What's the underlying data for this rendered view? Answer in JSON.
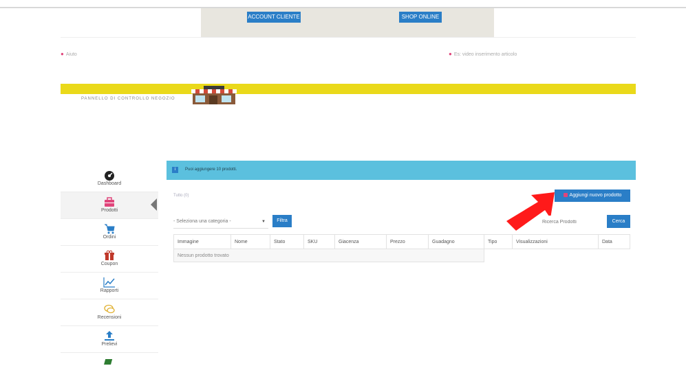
{
  "top_buttons": {
    "account": "ACCOUNT CLIENTE",
    "shop": "SHOP ONLINE"
  },
  "links": {
    "aiuto": "Aiuto",
    "video": "Es: video inserimento articolo"
  },
  "panel_label": "PANNELLO DI CONTROLLO NEGOZIO",
  "sidebar": {
    "items": [
      {
        "label": "Dashboard",
        "icon": "dashboard-icon",
        "color": "#222222"
      },
      {
        "label": "Prodotti",
        "icon": "briefcase-icon",
        "color": "#e0457b"
      },
      {
        "label": "Ordini",
        "icon": "cart-icon",
        "color": "#2a7ec7"
      },
      {
        "label": "Coupon",
        "icon": "gift-icon",
        "color": "#c0392b"
      },
      {
        "label": "Rapporti",
        "icon": "chart-icon",
        "color": "#2a7ec7"
      },
      {
        "label": "Recensioni",
        "icon": "comments-icon",
        "color": "#e0b030"
      },
      {
        "label": "Prelievi",
        "icon": "upload-icon",
        "color": "#2a7ec7"
      }
    ]
  },
  "alert": {
    "text": "Puoi aggiungere 10 prodotti."
  },
  "filter_tabs": {
    "all": "Tutto (0)"
  },
  "add_button": {
    "label": "Aggiungi nuovo prodotto"
  },
  "category_select": {
    "value": "- Seleziona una categoria -"
  },
  "filter_button": "Filtra",
  "search": {
    "placeholder": "Ricerca Prodotti"
  },
  "search_button": "Cerca",
  "table": {
    "headers": [
      "Immagine",
      "Nome",
      "Stato",
      "SKU",
      "Giacenza",
      "Prezzo",
      "Guadagno",
      "Tipo",
      "Visualizzazioni",
      "Data"
    ],
    "empty": "Nessun prodotto trovato"
  },
  "colors": {
    "accent": "#2a7ec7",
    "alert": "#5bc0de",
    "banner": "#ead91a",
    "arrow": "#ff1a1a"
  }
}
